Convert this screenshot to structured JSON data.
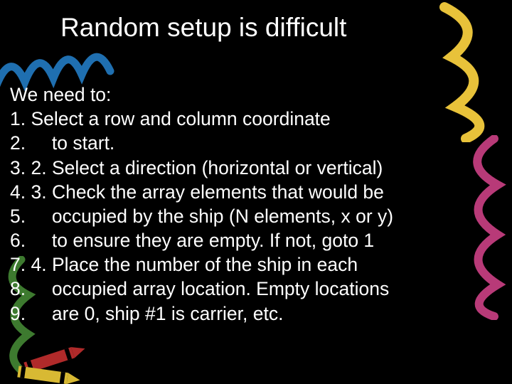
{
  "title": "Random setup is difficult",
  "intro": "We need to:",
  "lines": [
    {
      "num": "1.",
      "text": "Select a row and column coordinate"
    },
    {
      "num": "2.",
      "text": "    to start."
    },
    {
      "num": "3.",
      "text": "2. Select a direction (horizontal or vertical)"
    },
    {
      "num": "4.",
      "text": "3. Check the array elements that would be"
    },
    {
      "num": "5.",
      "text": "    occupied by the ship (N elements, x or y)"
    },
    {
      "num": "6.",
      "text": "    to ensure they are empty. If not, goto 1"
    },
    {
      "num": "7.",
      "text": "4. Place the number of the ship in each"
    },
    {
      "num": "8.",
      "text": "    occupied array location. Empty locations"
    },
    {
      "num": "9.",
      "text": "    are 0, ship #1 is carrier, etc."
    }
  ]
}
